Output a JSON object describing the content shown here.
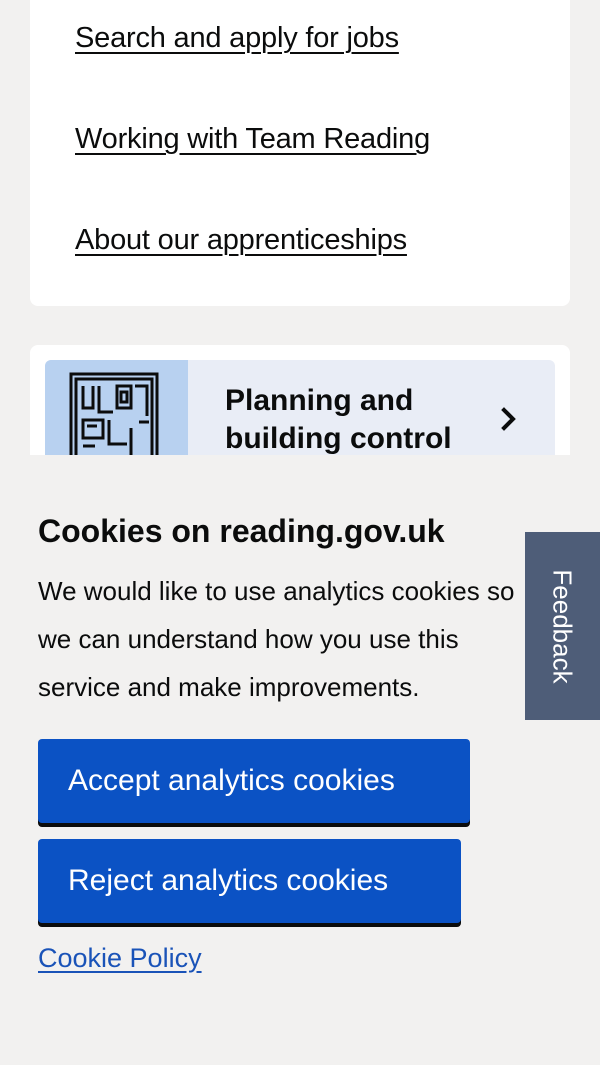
{
  "links": [
    {
      "label": "Search and apply for jobs"
    },
    {
      "label": "Working with Team Reading"
    },
    {
      "label": "About our apprenticeships"
    }
  ],
  "service_card": {
    "title": "Planning and building control",
    "icon": "floor-plan-icon",
    "chevron": "chevron-right-icon"
  },
  "cookie_banner": {
    "title": "Cookies on reading.gov.uk",
    "text": "We would like to use analytics cookies so we can understand how you use this service and make improvements.",
    "accept_label": "Accept analytics cookies",
    "reject_label": "Reject analytics cookies",
    "policy_link": "Cookie Policy"
  },
  "feedback": {
    "label": "Feedback"
  },
  "colors": {
    "background": "#f2f1f0",
    "button": "#0b52c4",
    "link": "#1a53b8",
    "feedback_tab": "#4e5d78",
    "card_tint": "#e9edf6",
    "icon_tint": "#b8d1f0"
  }
}
